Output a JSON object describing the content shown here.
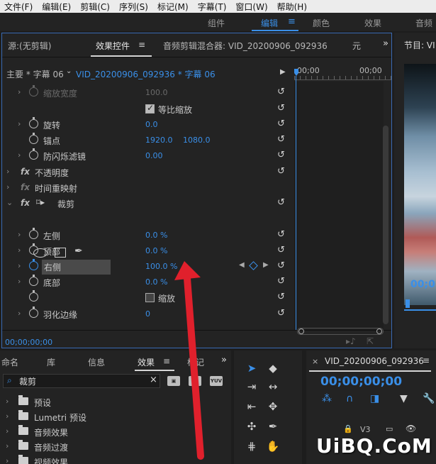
{
  "menu": [
    "文件(F)",
    "编辑(E)",
    "剪辑(C)",
    "序列(S)",
    "标记(M)",
    "字幕(T)",
    "窗口(W)",
    "帮助(H)"
  ],
  "workspaces": [
    "组件",
    "编辑",
    "颜色",
    "效果",
    "音频"
  ],
  "active_workspace": "编辑",
  "effect_controls": {
    "tab_source": "源:(无剪辑)",
    "tab_effects": "效果控件",
    "tab_menu_icon": "≡",
    "tab_audio_mixer": "音频剪辑混合器: VID_20200906_092936",
    "tab_more": "元",
    "header_source": "主要 * 字幕 06",
    "header_clip": "VID_20200906_092936 * 字幕 06",
    "ruler_tc1": "00;00",
    "ruler_tc2": "00;00",
    "rows": {
      "scale_width": {
        "label": "缩放宽度",
        "value": "100.0"
      },
      "uniform_scale": {
        "label": "等比缩放"
      },
      "rotation": {
        "label": "旋转",
        "value": "0.0"
      },
      "anchor": {
        "label": "锚点",
        "x": "1920.0",
        "y": "1080.0"
      },
      "anti_flicker": {
        "label": "防闪烁滤镜",
        "value": "0.00"
      },
      "opacity": {
        "label": "不透明度"
      },
      "time_remap": {
        "label": "时间重映射"
      },
      "crop": {
        "label": "裁剪"
      },
      "left": {
        "label": "左侧",
        "value": "0.0 %"
      },
      "top": {
        "label": "顶部",
        "value": "0.0 %"
      },
      "right": {
        "label": "右侧",
        "value": "100.0 %"
      },
      "bottom": {
        "label": "底部",
        "value": "0.0 %"
      },
      "zoom": {
        "label": "缩放"
      },
      "feather": {
        "label": "羽化边缘",
        "value": "0"
      }
    },
    "footer_timecode": "00;00;00;00"
  },
  "program_monitor": {
    "title": "节目: VI",
    "timecode": "00;0"
  },
  "effects_panel": {
    "tabs": [
      "命名",
      "库",
      "信息",
      "效果",
      "标记"
    ],
    "active_tab": "效果",
    "search_value": "裁剪",
    "items": [
      "预设",
      "Lumetri 预设",
      "音频效果",
      "音频过渡",
      "视频效果"
    ],
    "btn_labels": [
      "32",
      "YUV"
    ]
  },
  "timeline": {
    "sequence": "VID_20200906_092936",
    "timecode": "00;00;00;00",
    "track": "V3"
  },
  "watermark": "UiBQ.CoM",
  "colors": {
    "accent": "#3a8fe8",
    "annotation": "#e0202c"
  }
}
